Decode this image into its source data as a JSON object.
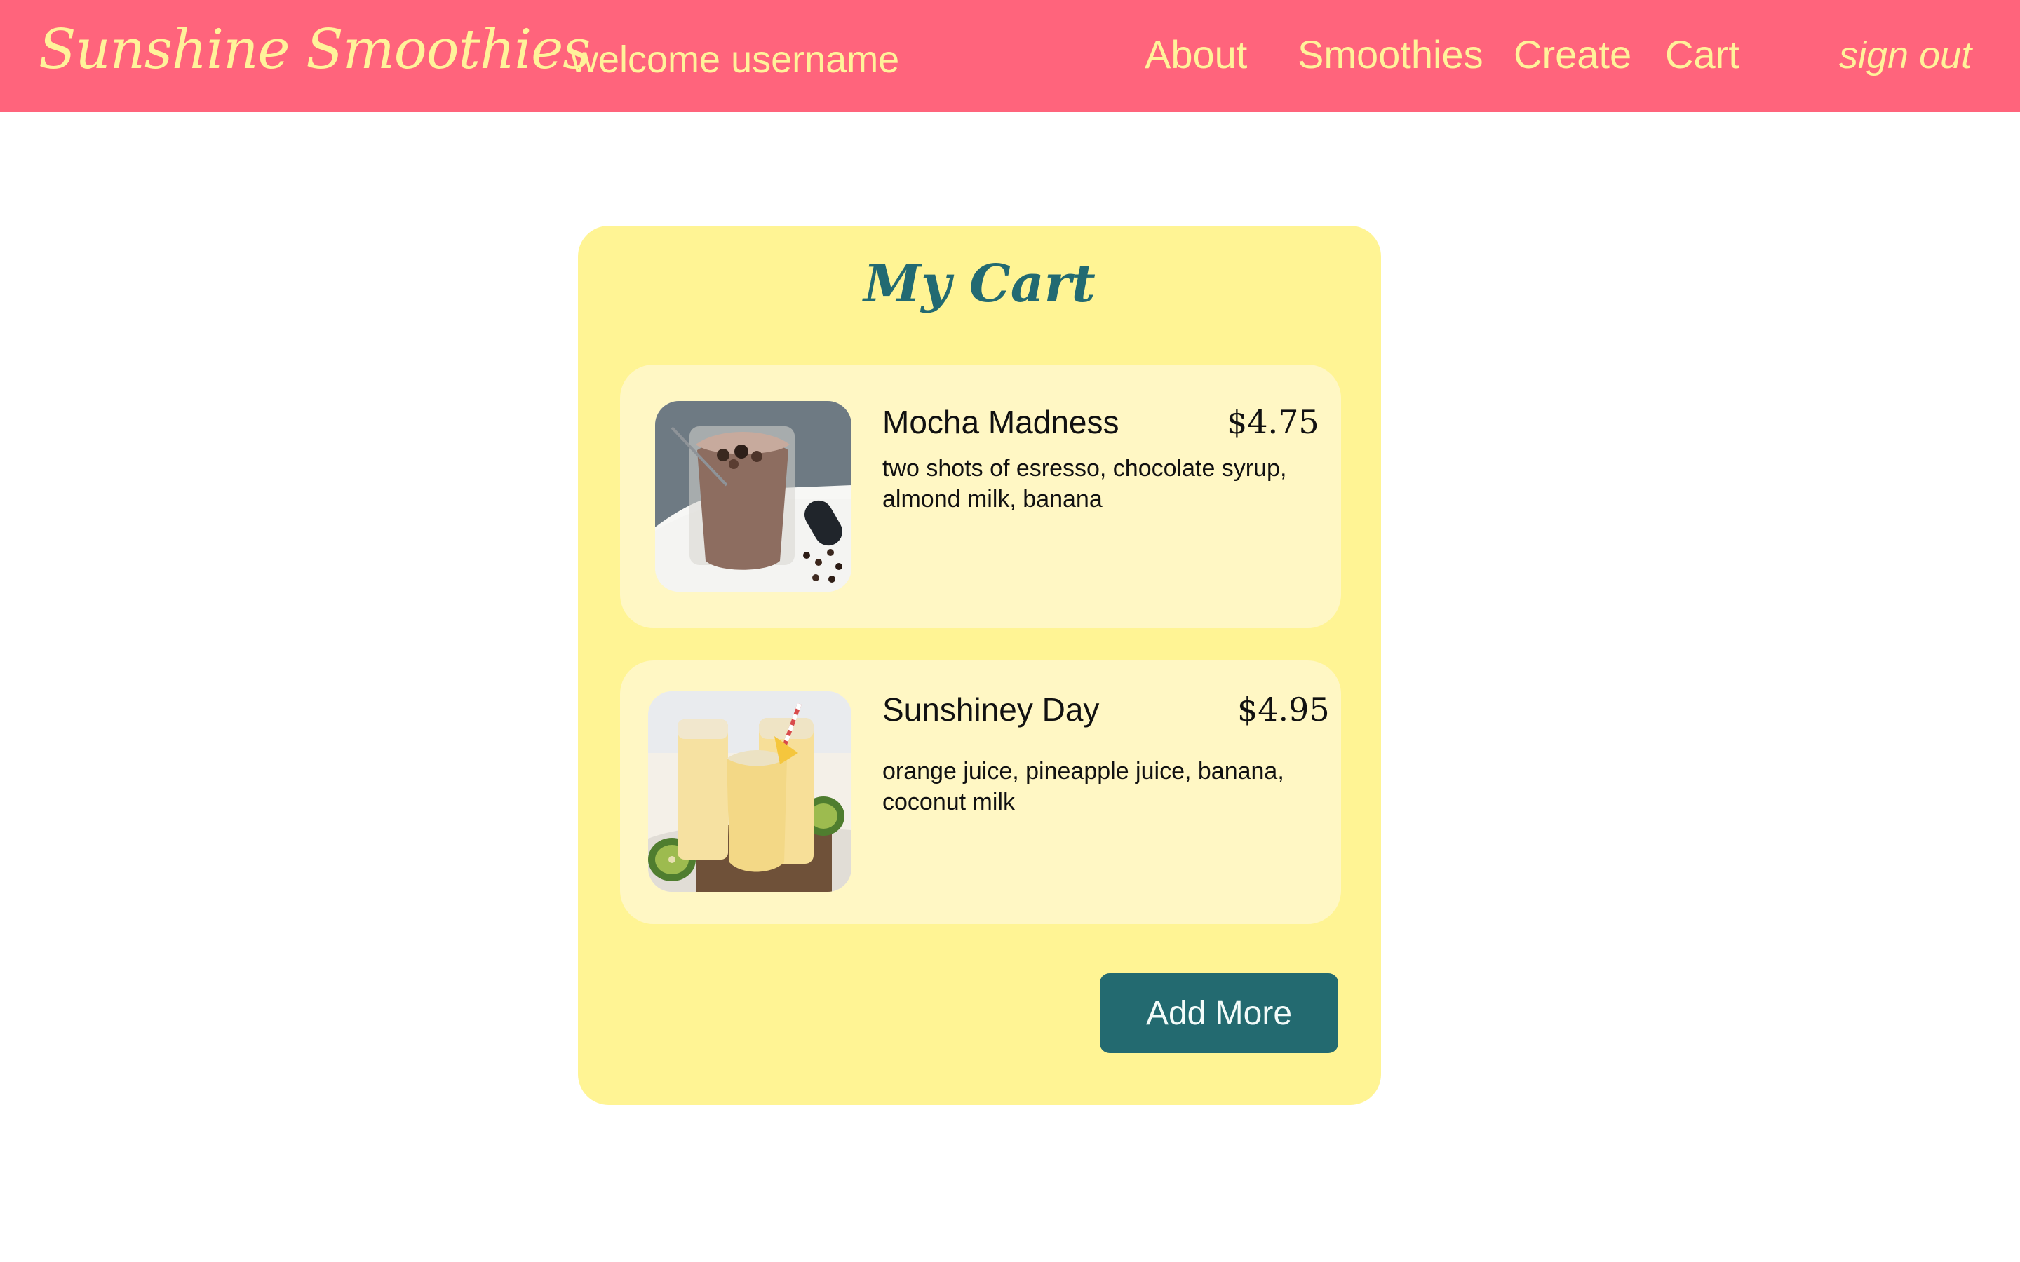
{
  "header": {
    "brand": "Sunshine Smoothies",
    "welcome": "welcome username",
    "nav": [
      "About",
      "Smoothies",
      "Create",
      "Cart"
    ],
    "sign_out": "sign out"
  },
  "cart": {
    "title": "My Cart",
    "items": [
      {
        "name": "Mocha Madness",
        "price": "$4.75",
        "description": "two shots of esresso, chocolate syrup, almond milk, banana"
      },
      {
        "name": "Sunshiney Day",
        "price": "$4.95",
        "description": "orange juice, pineapple juice, banana, coconut milk"
      }
    ],
    "add_more_label": "Add More"
  },
  "colors": {
    "header_bg": "#ff647c",
    "header_text": "#fff29a",
    "panel_bg": "#fff494",
    "card_bg": "#fff7c4",
    "title_color": "#226a72",
    "button_bg": "#236a70",
    "button_text": "#f3fbf9"
  }
}
